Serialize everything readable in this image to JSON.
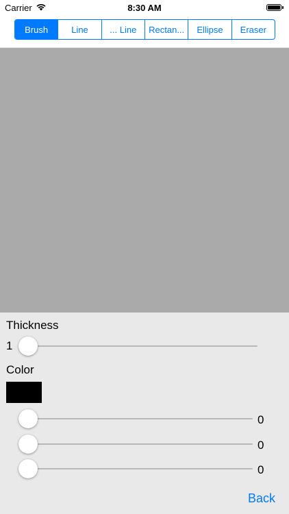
{
  "status_bar": {
    "carrier": "Carrier",
    "time": "8:30 AM",
    "icons": [
      "wifi-icon",
      "battery-icon"
    ]
  },
  "tools": {
    "selected_index": 0,
    "items": [
      {
        "label": "Brush"
      },
      {
        "label": "Line"
      },
      {
        "label": "... Line"
      },
      {
        "label": "Rectan..."
      },
      {
        "label": "Ellipse"
      },
      {
        "label": "Eraser"
      }
    ]
  },
  "canvas": {
    "background_color": "#aaaaaa"
  },
  "thickness": {
    "label": "Thickness",
    "value": "1",
    "slider_level": 0
  },
  "color": {
    "label": "Color",
    "swatch_color": "#000000",
    "channels": [
      {
        "value": "0",
        "slider_level": 0
      },
      {
        "value": "0",
        "slider_level": 0
      },
      {
        "value": "0",
        "slider_level": 0
      }
    ]
  },
  "back_button": {
    "label": "Back"
  },
  "colors": {
    "accent": "#007aff",
    "panel_background": "#e9e9e9",
    "track": "#b8b8b8"
  }
}
